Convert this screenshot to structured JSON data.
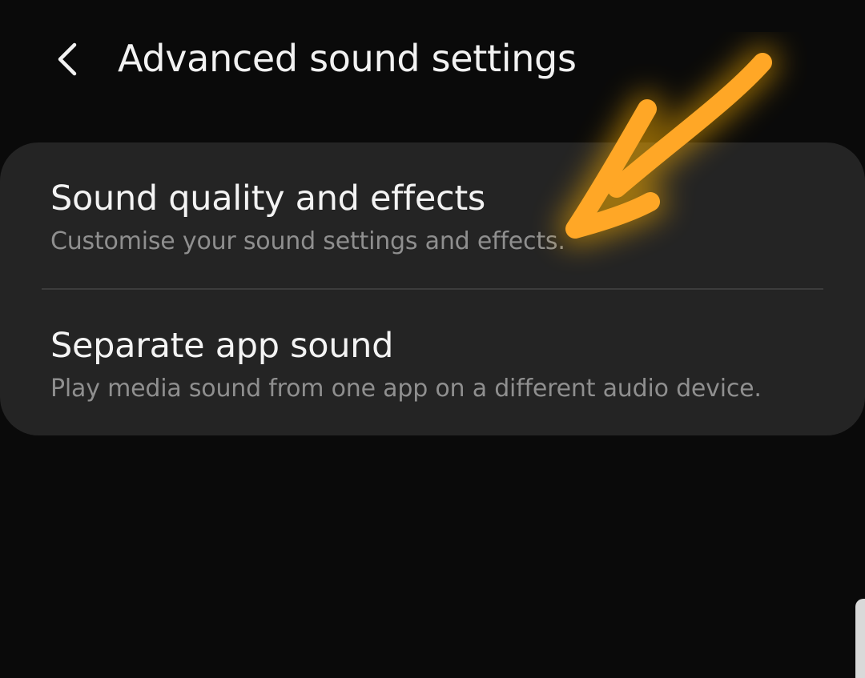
{
  "header": {
    "title": "Advanced sound settings",
    "back_icon": "chevron-left-icon"
  },
  "settings_card": {
    "items": [
      {
        "title": "Sound quality and effects",
        "description": "Customise your sound settings and effects."
      },
      {
        "title": "Separate app sound",
        "description": "Play media sound from one app on a different audio device."
      }
    ]
  },
  "annotation": {
    "type": "hand-drawn-arrow",
    "icon": "arrow-annotation-icon",
    "color": "#FFA726",
    "glow_color": "#FFB300"
  },
  "colors": {
    "background": "#0A0A0A",
    "card": "#242424",
    "title_text": "#F2F2F2",
    "description_text": "#8F8F8F"
  }
}
